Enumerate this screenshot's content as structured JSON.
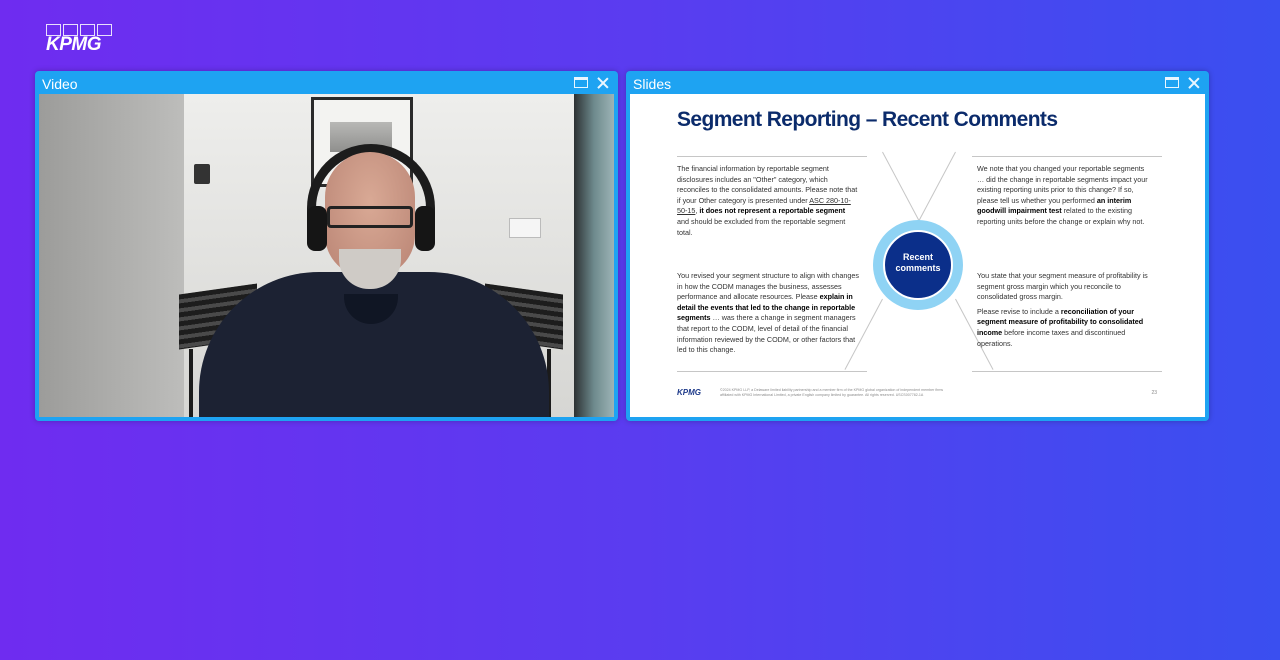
{
  "brand": {
    "logo_text": "KPMG"
  },
  "video_panel": {
    "title": "Video"
  },
  "slides_panel": {
    "title": "Slides"
  },
  "slide": {
    "title": "Segment Reporting – Recent Comments",
    "center_label_line1": "Recent",
    "center_label_line2": "comments",
    "top_left": {
      "part1": "The financial information by reportable segment disclosures includes an \"Other\" category, which reconciles to the consolidated amounts. Please note that if your Other category is presented under ",
      "link": "ASC 280-10-50-15",
      "part2": ", ",
      "bold": "it does not represent a reportable segment",
      "part3": " and should be excluded from the reportable segment total."
    },
    "bottom_left": {
      "part1": "You revised your segment structure to align with changes in how the CODM manages the business, assesses performance and allocate resources. Please ",
      "bold": "explain in detail the events that led to the change in reportable segments",
      "part2": " … was there a change in segment managers that report to the CODM, level of detail of the financial information reviewed by the CODM, or other factors that led to this change."
    },
    "top_right": {
      "part1": "We note that you changed your reportable segments … did the change in reportable segments impact your existing reporting units prior to this change?  If so, please tell us whether you performed ",
      "bold": "an interim goodwill impairment test",
      "part2": " related to the existing reporting units before the change or explain why not."
    },
    "bottom_right": {
      "para1": "You state that your segment measure of profitability is segment gross margin which you reconcile to consolidated gross margin.",
      "part1": "Please revise to include a ",
      "bold": "reconciliation of your segment measure of profitability to consolidated income",
      "part2": " before income taxes and discontinued operations."
    },
    "footer_logo": "KPMG",
    "footer_text": "©2024 KPMG LLP, a Delaware limited liability partnership and a member firm of the KPMG global organization of independent member firms affiliated with KPMG International Limited, a private English company limited by guarantee. All rights reserved. USCS007782-1A",
    "page_number": "23"
  }
}
